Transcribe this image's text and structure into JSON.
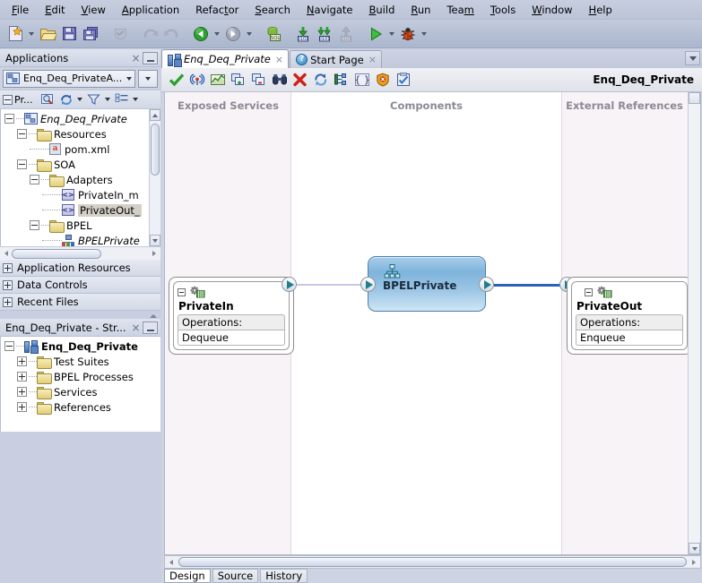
{
  "window": {
    "title": "Enq_Deq_Private"
  },
  "menubar": {
    "items": [
      {
        "label": "File",
        "mnemonic": "F"
      },
      {
        "label": "Edit",
        "mnemonic": "E"
      },
      {
        "label": "View",
        "mnemonic": "V"
      },
      {
        "label": "Application",
        "mnemonic": "A"
      },
      {
        "label": "Refactor",
        "mnemonic": "t"
      },
      {
        "label": "Search",
        "mnemonic": "S"
      },
      {
        "label": "Navigate",
        "mnemonic": "N"
      },
      {
        "label": "Build",
        "mnemonic": "B"
      },
      {
        "label": "Run",
        "mnemonic": "R"
      },
      {
        "label": "Team",
        "mnemonic": "m"
      },
      {
        "label": "Tools",
        "mnemonic": "T"
      },
      {
        "label": "Window",
        "mnemonic": "W"
      },
      {
        "label": "Help",
        "mnemonic": "H"
      }
    ]
  },
  "toolbar": {
    "buttons": [
      {
        "name": "new-icon",
        "tip": "New"
      },
      {
        "name": "new-dropdown-arrow",
        "tip": "New dropdown"
      },
      {
        "name": "open-folder-icon",
        "tip": "Open"
      },
      {
        "name": "save-icon",
        "tip": "Save"
      },
      {
        "name": "save-all-icon",
        "tip": "Save All"
      },
      {
        "name": "stamp-icon",
        "tip": "Reformat"
      },
      {
        "name": "undo-icon",
        "tip": "Undo"
      },
      {
        "name": "redo-icon",
        "tip": "Redo"
      },
      {
        "name": "back-icon",
        "tip": "Back"
      },
      {
        "name": "back-dropdown-arrow",
        "tip": "Back dropdown"
      },
      {
        "name": "forward-icon",
        "tip": "Forward"
      },
      {
        "name": "forward-dropdown-arrow",
        "tip": "Forward dropdown"
      },
      {
        "name": "sql-worksheet-icon",
        "tip": "SQL Worksheet"
      },
      {
        "name": "step-into-icon",
        "tip": "Step Into"
      },
      {
        "name": "step-over-icon",
        "tip": "Step Over"
      },
      {
        "name": "step-out-icon",
        "tip": "Step Out"
      },
      {
        "name": "run-icon",
        "tip": "Run"
      },
      {
        "name": "run-dropdown-arrow",
        "tip": "Run dropdown"
      },
      {
        "name": "debug-icon",
        "tip": "Debug"
      },
      {
        "name": "debug-dropdown-arrow",
        "tip": "Debug dropdown"
      }
    ]
  },
  "applications_panel": {
    "title": "Applications",
    "close_label": "×",
    "selected_application": "Enq_Deq_PrivateA...",
    "tree_toolbar": {
      "projects_label": "Pr...",
      "buttons": [
        {
          "name": "search-projects-icon"
        },
        {
          "name": "refresh-icon"
        },
        {
          "name": "filter-icon"
        },
        {
          "name": "view-options-icon"
        }
      ]
    },
    "tree": [
      {
        "label": "Enq_Deq_Private",
        "icon": "application-icon",
        "depth": 0,
        "expander": "minus",
        "italic": true,
        "selected": false
      },
      {
        "label": "Resources",
        "icon": "folder-icon",
        "depth": 1,
        "expander": "minus",
        "italic": false,
        "selected": false
      },
      {
        "label": "pom.xml",
        "icon": "maven-pom-icon",
        "depth": 2,
        "expander": "none",
        "italic": false,
        "selected": false
      },
      {
        "label": "SOA",
        "icon": "folder-icon",
        "depth": 1,
        "expander": "minus",
        "italic": false,
        "selected": false
      },
      {
        "label": "Adapters",
        "icon": "folder-icon",
        "depth": 2,
        "expander": "minus",
        "italic": false,
        "selected": false
      },
      {
        "label": "PrivateIn_m",
        "icon": "wsdl-icon",
        "depth": 3,
        "expander": "none",
        "italic": false,
        "selected": false
      },
      {
        "label": "PrivateOut_",
        "icon": "wsdl-icon",
        "depth": 3,
        "expander": "none",
        "italic": false,
        "selected": true
      },
      {
        "label": "BPEL",
        "icon": "folder-icon",
        "depth": 2,
        "expander": "minus",
        "italic": false,
        "selected": false
      },
      {
        "label": "BPELPrivate",
        "icon": "bpel-icon",
        "depth": 3,
        "expander": "none",
        "italic": true,
        "selected": false
      }
    ],
    "collapsed_sections": [
      {
        "label": "Application Resources"
      },
      {
        "label": "Data Controls"
      },
      {
        "label": "Recent Files"
      }
    ]
  },
  "structure_panel": {
    "title": "Enq_Deq_Private - Str...",
    "close_label": "×",
    "tree": [
      {
        "label": "Enq_Deq_Private",
        "icon": "soa-composite-icon",
        "depth": 0,
        "expander": "minus",
        "bold": true
      },
      {
        "label": "Test Suites",
        "icon": "folder-icon",
        "depth": 1,
        "expander": "plus",
        "bold": false
      },
      {
        "label": "BPEL Processes",
        "icon": "folder-icon",
        "depth": 1,
        "expander": "plus",
        "bold": false
      },
      {
        "label": "Services",
        "icon": "folder-icon",
        "depth": 1,
        "expander": "plus",
        "bold": false
      },
      {
        "label": "References",
        "icon": "folder-icon",
        "depth": 1,
        "expander": "plus",
        "bold": false
      }
    ]
  },
  "editor": {
    "tabs": [
      {
        "label": "Start Page",
        "icon": "help-circle-icon",
        "active": false,
        "italic": false,
        "close_label": "×"
      },
      {
        "label": "Enq_Deq_Private",
        "icon": "soa-composite-icon",
        "active": true,
        "italic": true,
        "close_label": "×"
      }
    ],
    "toolbar_buttons": [
      {
        "name": "validate-check-icon"
      },
      {
        "name": "deploy-antenna-icon"
      },
      {
        "name": "chart-icon"
      },
      {
        "name": "add-component-icon"
      },
      {
        "name": "remove-component-icon"
      },
      {
        "name": "find-binoculars-icon"
      },
      {
        "name": "delete-red-x-icon"
      },
      {
        "name": "refresh-blue-icon"
      },
      {
        "name": "composite-icon"
      },
      {
        "name": "braces-icon"
      },
      {
        "name": "security-shield-icon"
      },
      {
        "name": "policy-clipboard-icon"
      }
    ],
    "document_title": "Enq_Deq_Private",
    "bottom_tabs": [
      {
        "label": "Design",
        "active": true
      },
      {
        "label": "Source",
        "active": false
      },
      {
        "label": "History",
        "active": false
      }
    ]
  },
  "composite": {
    "columns": [
      {
        "label": "Exposed Services",
        "name": "exposed-services-column"
      },
      {
        "label": "Components",
        "name": "components-column"
      },
      {
        "label": "External References",
        "name": "external-references-column"
      }
    ],
    "exposed_service": {
      "name": "PrivateIn",
      "operations_label": "Operations:",
      "operations": [
        "Dequeue"
      ],
      "icon": "adapter-gear-icon"
    },
    "component": {
      "name": "BPELPrivate",
      "icon": "bpel-process-icon"
    },
    "external_reference": {
      "name": "PrivateOut",
      "operations_label": "Operations:",
      "operations": [
        "Enqueue"
      ],
      "icon": "adapter-gear-icon"
    },
    "wires": [
      {
        "name": "wire-privatein-to-bpel",
        "color": "#c8c6e8"
      },
      {
        "name": "wire-bpel-to-privateout",
        "color": "#2a62b8"
      }
    ]
  },
  "colors": {
    "chrome": "#c9cfe0",
    "column_tint": "#f8f3f6",
    "bpel_fill": "#8fbde1",
    "accent_blue": "#2a62b8",
    "header_text": "#8e8896"
  }
}
